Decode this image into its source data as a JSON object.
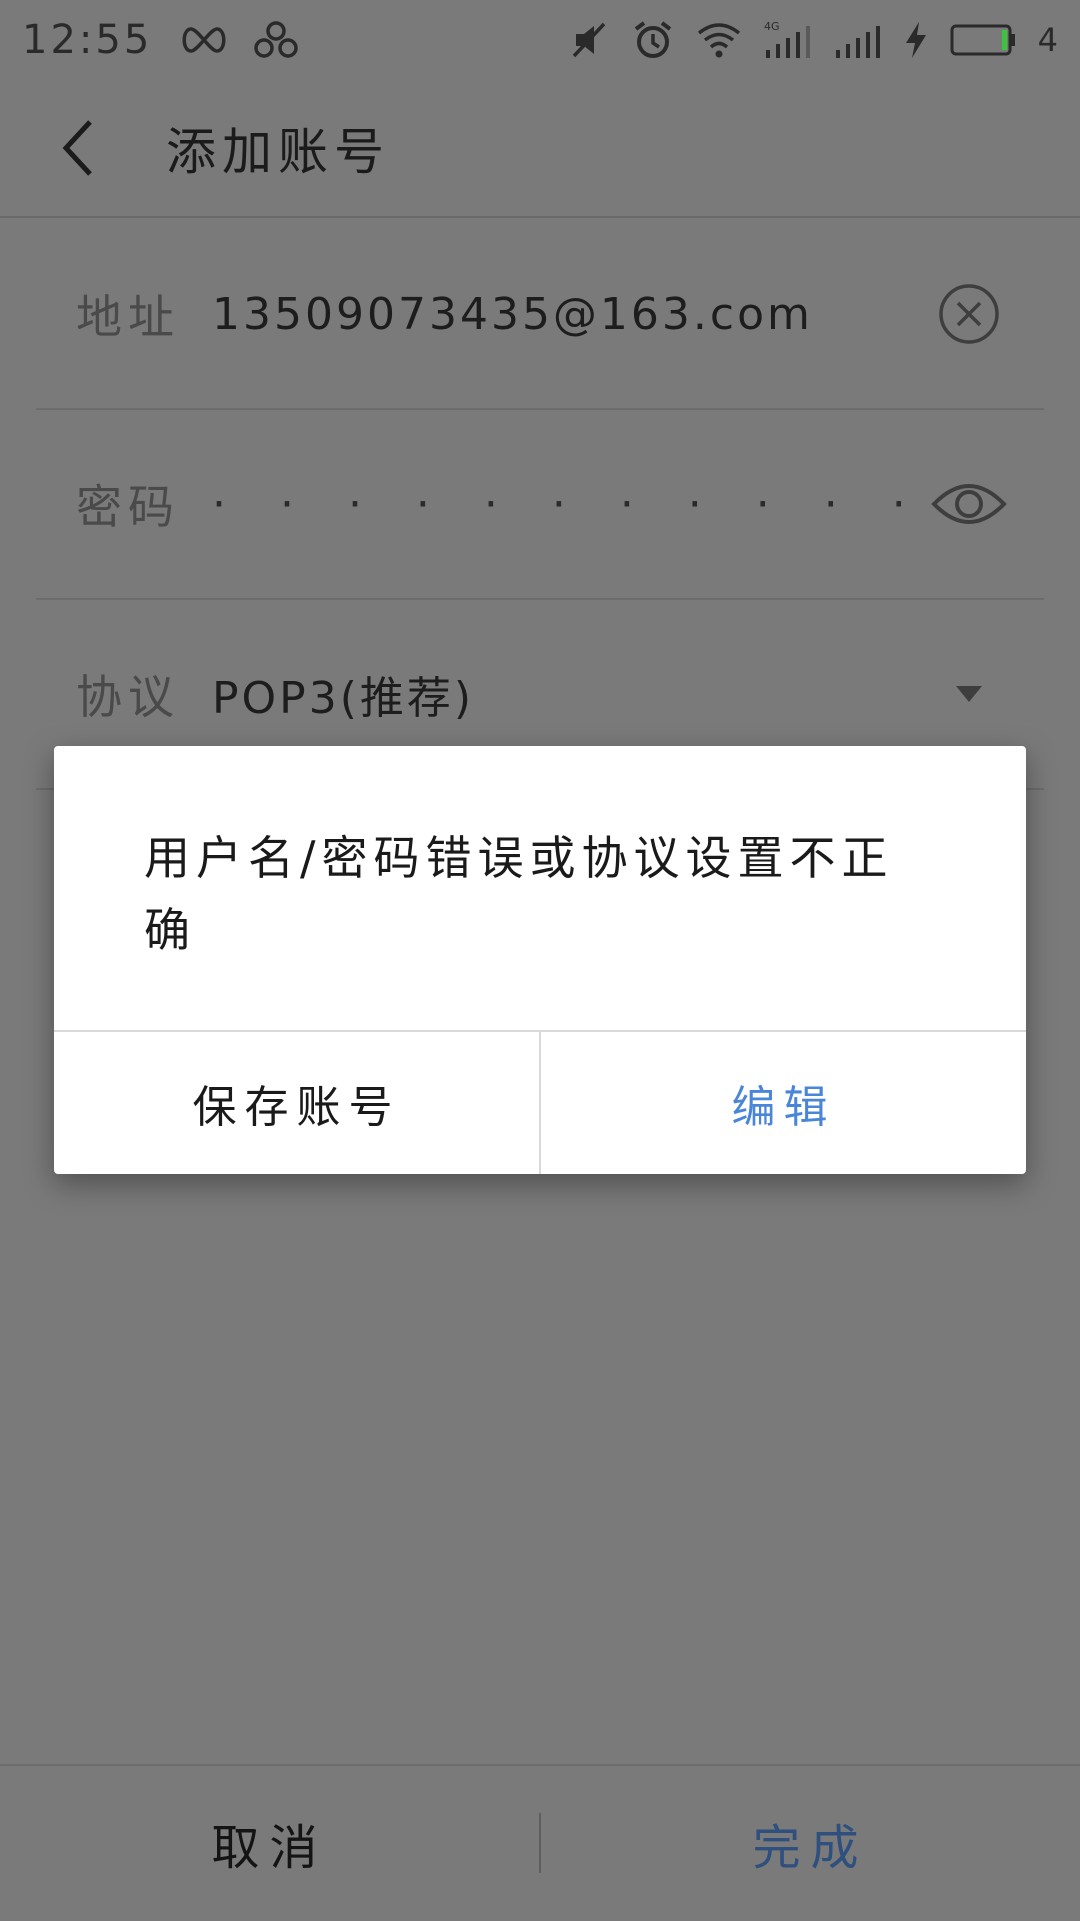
{
  "status_bar": {
    "time": "12:55",
    "battery_level": "4",
    "icons": [
      "infinity-icon",
      "cloud-icon",
      "mute-icon",
      "alarm-icon",
      "wifi-icon",
      "signal-4g-icon",
      "signal-icon",
      "charging-icon",
      "battery-icon"
    ],
    "battery_fill_color": "#3cc43c"
  },
  "app_bar": {
    "title": "添加账号"
  },
  "form": {
    "address": {
      "label": "地址",
      "value": "13509073435@163.com"
    },
    "password": {
      "label": "密码",
      "value": "· · · · · · · · · · · ·"
    },
    "protocol": {
      "label": "协议",
      "value": "POP3(推荐)"
    }
  },
  "dialog": {
    "message": "用户名/密码错误或协议设置不正确",
    "save_label": "保存账号",
    "edit_label": "编辑",
    "edit_color": "#4a86d8"
  },
  "bottom_bar": {
    "cancel_label": "取消",
    "done_label": "完成"
  }
}
